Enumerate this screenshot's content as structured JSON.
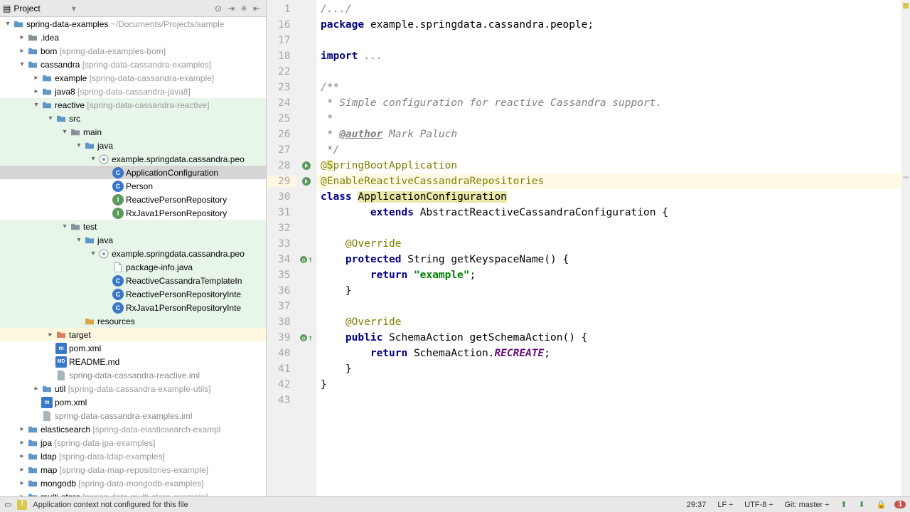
{
  "sidebar": {
    "title": "Project",
    "tree": [
      {
        "d": 0,
        "a": "open",
        "i": "module",
        "label": "spring-data-examples",
        "hint": " ~/Documents/Projects/sample"
      },
      {
        "d": 1,
        "a": "closed",
        "i": "folder",
        "label": ".idea"
      },
      {
        "d": 1,
        "a": "closed",
        "i": "module",
        "label": "bom ",
        "hint": "[spring-data-examples-bom]"
      },
      {
        "d": 1,
        "a": "open",
        "i": "module",
        "label": "cassandra ",
        "hint": "[spring-data-cassandra-examples]"
      },
      {
        "d": 2,
        "a": "closed",
        "i": "module",
        "label": "example ",
        "hint": "[spring-data-cassandra-example]"
      },
      {
        "d": 2,
        "a": "closed",
        "i": "module",
        "label": "java8 ",
        "hint": "[spring-data-cassandra-java8]"
      },
      {
        "d": 2,
        "a": "open",
        "i": "module",
        "label": "reactive ",
        "hint": "[spring-data-cassandra-reactive]",
        "mod": true
      },
      {
        "d": 3,
        "a": "open",
        "i": "srcfolder",
        "label": "src",
        "mod": true
      },
      {
        "d": 4,
        "a": "open",
        "i": "folder",
        "label": "main",
        "mod": true
      },
      {
        "d": 5,
        "a": "open",
        "i": "srcfolder",
        "label": "java",
        "mod": true
      },
      {
        "d": 6,
        "a": "open",
        "i": "pkg",
        "label": "example.springdata.cassandra.peo",
        "mod": true
      },
      {
        "d": 7,
        "a": "none",
        "i": "class",
        "label": "ApplicationConfiguration",
        "sel": true
      },
      {
        "d": 7,
        "a": "none",
        "i": "class",
        "label": "Person"
      },
      {
        "d": 7,
        "a": "none",
        "i": "iface",
        "label": "ReactivePersonRepository"
      },
      {
        "d": 7,
        "a": "none",
        "i": "iface",
        "label": "RxJava1PersonRepository"
      },
      {
        "d": 4,
        "a": "open",
        "i": "folder",
        "label": "test",
        "mod": true
      },
      {
        "d": 5,
        "a": "open",
        "i": "srcfolder",
        "label": "java",
        "mod": true
      },
      {
        "d": 6,
        "a": "open",
        "i": "pkg",
        "label": "example.springdata.cassandra.peo",
        "mod": true
      },
      {
        "d": 7,
        "a": "none",
        "i": "file",
        "label": "package-info.java",
        "mod": true
      },
      {
        "d": 7,
        "a": "none",
        "i": "class",
        "label": "ReactiveCassandraTemplateIn",
        "mod": true
      },
      {
        "d": 7,
        "a": "none",
        "i": "class",
        "label": "ReactivePersonRepositoryInte",
        "mod": true
      },
      {
        "d": 7,
        "a": "none",
        "i": "class",
        "label": "RxJava1PersonRepositoryInte",
        "mod": true
      },
      {
        "d": 5,
        "a": "none",
        "i": "resfolder",
        "label": "resources",
        "mod": true
      },
      {
        "d": 3,
        "a": "closed",
        "i": "target",
        "label": "target",
        "hl": true
      },
      {
        "d": 3,
        "a": "none",
        "i": "maven",
        "label": "pom.xml"
      },
      {
        "d": 3,
        "a": "none",
        "i": "md",
        "label": "README.md"
      },
      {
        "d": 3,
        "a": "none",
        "i": "iml",
        "label": "spring-data-cassandra-reactive.iml",
        "grey": true
      },
      {
        "d": 2,
        "a": "closed",
        "i": "module",
        "label": "util ",
        "hint": "[spring-data-cassandra-example-utils]"
      },
      {
        "d": 2,
        "a": "none",
        "i": "maven",
        "label": "pom.xml"
      },
      {
        "d": 2,
        "a": "none",
        "i": "iml",
        "label": "spring-data-cassandra-examples.iml",
        "grey": true
      },
      {
        "d": 1,
        "a": "closed",
        "i": "module",
        "label": "elasticsearch ",
        "hint": "[spring-data-elasticsearch-exampl"
      },
      {
        "d": 1,
        "a": "closed",
        "i": "module",
        "label": "jpa ",
        "hint": "[spring-data-jpa-examples]"
      },
      {
        "d": 1,
        "a": "closed",
        "i": "module",
        "label": "ldap ",
        "hint": "[spring-data-ldap-examples]"
      },
      {
        "d": 1,
        "a": "closed",
        "i": "module",
        "label": "map ",
        "hint": "[spring-data-map-repositories-example]"
      },
      {
        "d": 1,
        "a": "closed",
        "i": "module",
        "label": "mongodb ",
        "hint": "[spring-data-mongodb-examples]"
      },
      {
        "d": 1,
        "a": "closed",
        "i": "module",
        "label": "multi-store ",
        "hint": "[spring-data-multi-store-example]"
      }
    ]
  },
  "editor": {
    "lines": [
      {
        "n": 1,
        "seg": [
          {
            "t": "/.../",
            "c": "tok-fold"
          }
        ]
      },
      {
        "n": 16,
        "seg": [
          {
            "t": "package ",
            "c": "tok-kw"
          },
          {
            "t": "example.springdata.cassandra.people;"
          }
        ]
      },
      {
        "n": 17,
        "seg": []
      },
      {
        "n": 18,
        "seg": [
          {
            "t": "import ",
            "c": "tok-kw"
          },
          {
            "t": "...",
            "c": "tok-fold"
          }
        ]
      },
      {
        "n": 22,
        "seg": []
      },
      {
        "n": 23,
        "seg": [
          {
            "t": "/**",
            "c": "tok-doc"
          }
        ]
      },
      {
        "n": 24,
        "seg": [
          {
            "t": " * Simple configuration for reactive Cassandra support.",
            "c": "tok-doc"
          }
        ]
      },
      {
        "n": 25,
        "seg": [
          {
            "t": " *",
            "c": "tok-doc"
          }
        ]
      },
      {
        "n": 26,
        "seg": [
          {
            "t": " * ",
            "c": "tok-doc"
          },
          {
            "t": "@author",
            "c": "tok-doctag"
          },
          {
            "t": " Mark Paluch",
            "c": "tok-doc"
          }
        ]
      },
      {
        "n": 27,
        "seg": [
          {
            "t": " */",
            "c": "tok-doc"
          }
        ]
      },
      {
        "n": 28,
        "seg": [
          {
            "t": "@",
            "c": "tok-ann"
          },
          {
            "t": "S",
            "c": "tok-ann tok-hl"
          },
          {
            "t": "pringBootApplication",
            "c": "tok-ann"
          }
        ],
        "marker": "run"
      },
      {
        "n": 29,
        "seg": [
          {
            "t": "@EnableReactiveCassandraRepositories",
            "c": "tok-ann"
          }
        ],
        "marker": "run",
        "caret": true
      },
      {
        "n": 30,
        "seg": [
          {
            "t": "class ",
            "c": "tok-kw"
          },
          {
            "t": "ApplicationConfiguration",
            "c": "tok-hl"
          }
        ]
      },
      {
        "n": 31,
        "seg": [
          {
            "t": "        "
          },
          {
            "t": "extends ",
            "c": "tok-kw"
          },
          {
            "t": "AbstractReactiveCassandraConfiguration {"
          }
        ]
      },
      {
        "n": 32,
        "seg": []
      },
      {
        "n": 33,
        "seg": [
          {
            "t": "    "
          },
          {
            "t": "@Override",
            "c": "tok-ann"
          }
        ]
      },
      {
        "n": 34,
        "seg": [
          {
            "t": "    "
          },
          {
            "t": "protected ",
            "c": "tok-kw"
          },
          {
            "t": "String getKeyspaceName() {"
          }
        ],
        "marker": "override"
      },
      {
        "n": 35,
        "seg": [
          {
            "t": "        "
          },
          {
            "t": "return ",
            "c": "tok-kw"
          },
          {
            "t": "\"example\"",
            "c": "tok-str"
          },
          {
            "t": ";"
          }
        ]
      },
      {
        "n": 36,
        "seg": [
          {
            "t": "    }"
          }
        ]
      },
      {
        "n": 37,
        "seg": []
      },
      {
        "n": 38,
        "seg": [
          {
            "t": "    "
          },
          {
            "t": "@Override",
            "c": "tok-ann"
          }
        ]
      },
      {
        "n": 39,
        "seg": [
          {
            "t": "    "
          },
          {
            "t": "public ",
            "c": "tok-kw"
          },
          {
            "t": "SchemaAction getSchemaAction() {"
          }
        ],
        "marker": "override"
      },
      {
        "n": 40,
        "seg": [
          {
            "t": "        "
          },
          {
            "t": "return ",
            "c": "tok-kw"
          },
          {
            "t": "SchemaAction."
          },
          {
            "t": "RECREATE",
            "c": "tok-const"
          },
          {
            "t": ";"
          }
        ]
      },
      {
        "n": 41,
        "seg": [
          {
            "t": "    }"
          }
        ]
      },
      {
        "n": 42,
        "seg": [
          {
            "t": "}"
          }
        ]
      },
      {
        "n": 43,
        "seg": []
      }
    ]
  },
  "status": {
    "message": "Application context not configured for this file",
    "pos": "29:37",
    "linesep": "LF",
    "encoding": "UTF-8",
    "git_label": "Git: ",
    "git_branch": "master",
    "badge": "1"
  }
}
